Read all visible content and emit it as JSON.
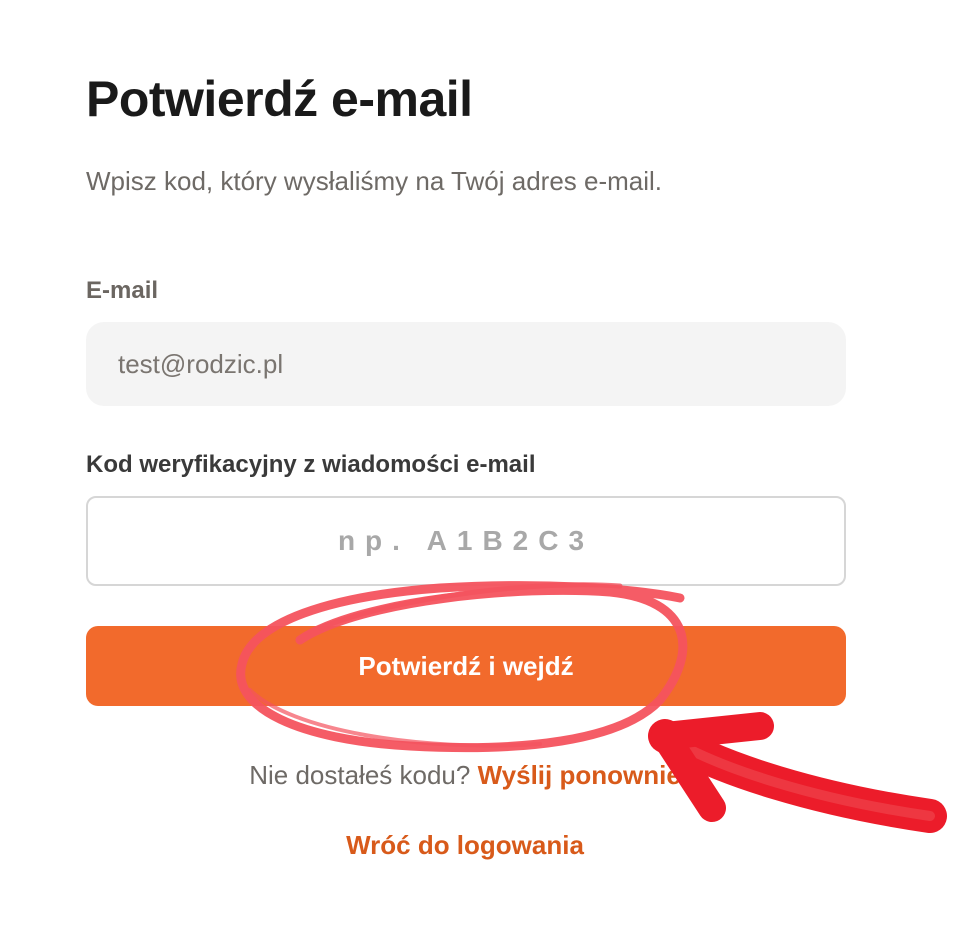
{
  "header": {
    "title": "Potwierdź e-mail",
    "subtitle": "Wpisz kod, który wysłaliśmy na Twój adres e-mail."
  },
  "form": {
    "email_label": "E-mail",
    "email_value": "test@rodzic.pl",
    "code_label": "Kod weryfikacyjny z wiadomości e-mail",
    "code_placeholder": "np. A1B2C3",
    "submit_label": "Potwierdź i wejdź"
  },
  "footer": {
    "resend_prompt": "Nie dostałeś kodu?",
    "resend_link": "Wyślij ponownie",
    "back_link": "Wróć do logowania"
  },
  "colors": {
    "accent": "#f26a2c",
    "link": "#d85a1a",
    "annotation_circle": "#f4535e",
    "annotation_arrow": "#ec1c2a"
  },
  "annotations": [
    {
      "type": "circle",
      "target": "submit-button"
    },
    {
      "type": "arrow",
      "target": "submit-button"
    }
  ]
}
